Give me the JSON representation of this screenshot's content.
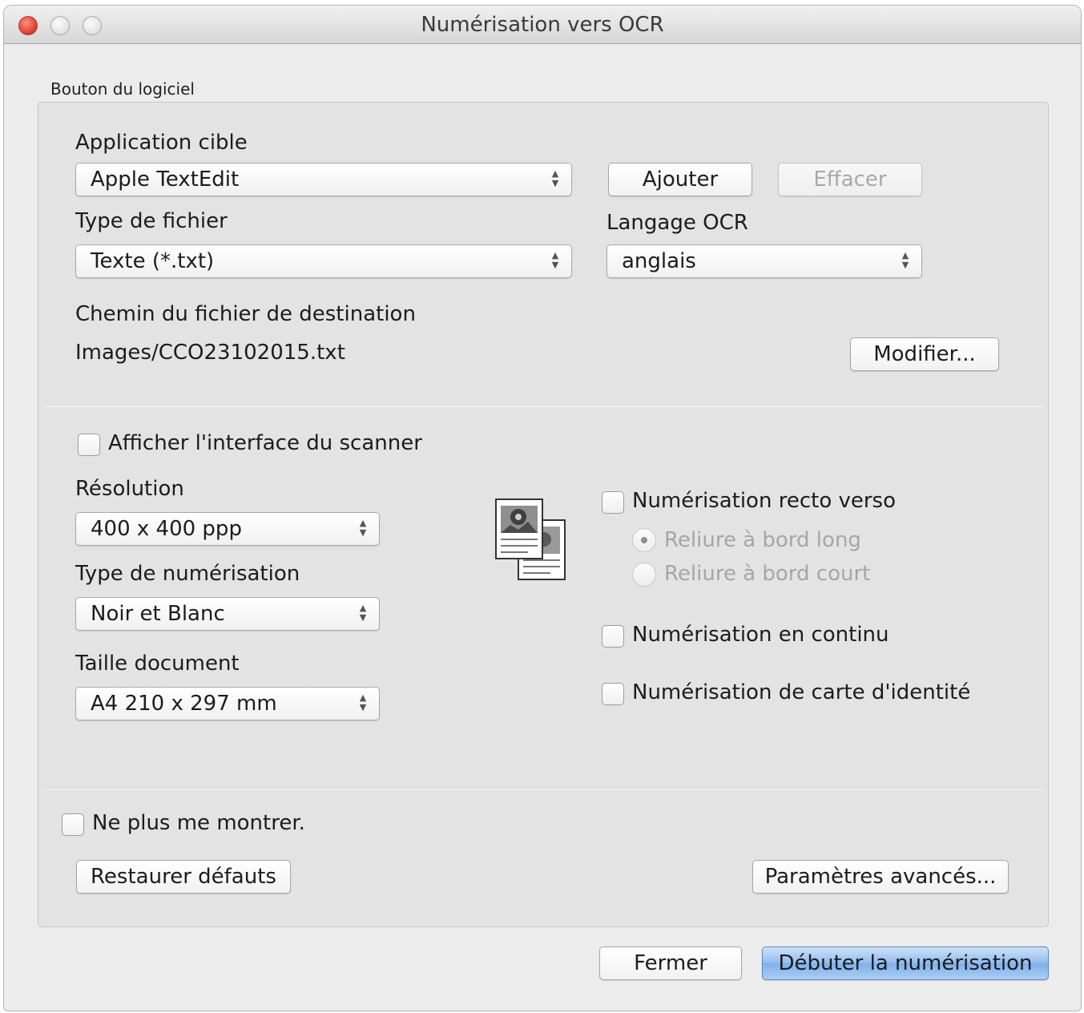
{
  "window": {
    "title": "Numérisation vers OCR"
  },
  "group": {
    "label": "Bouton du logiciel"
  },
  "target_app": {
    "label": "Application cible",
    "value": "Apple TextEdit",
    "add_button": "Ajouter",
    "delete_button": "Effacer"
  },
  "file_type": {
    "label": "Type de fichier",
    "value": "Texte (*.txt)"
  },
  "ocr_language": {
    "label": "Langage OCR",
    "value": "anglais"
  },
  "destination": {
    "label": "Chemin du fichier de destination",
    "path": "Images/CCO23102015.txt",
    "modify_button": "Modifier..."
  },
  "scanner_ui": {
    "label": "Afficher l'interface du scanner",
    "checked": false
  },
  "resolution": {
    "label": "Résolution",
    "value": "400 x 400 ppp"
  },
  "scan_type": {
    "label": "Type de numérisation",
    "value": "Noir et Blanc"
  },
  "doc_size": {
    "label": "Taille document",
    "value": "A4 210 x 297 mm"
  },
  "duplex": {
    "label": "Numérisation recto verso",
    "checked": false,
    "long_edge": "Reliure à bord long",
    "short_edge": "Reliure à bord court",
    "selected": "long_edge"
  },
  "continuous": {
    "label": "Numérisation en continu",
    "checked": false
  },
  "id_card": {
    "label": "Numérisation de carte d'identité",
    "checked": false
  },
  "dont_show": {
    "label": "Ne plus me montrer.",
    "checked": false
  },
  "restore_button": "Restaurer défauts",
  "advanced_button": "Paramètres avancés...",
  "close_button": "Fermer",
  "start_button": "Débuter la numérisation",
  "icons": {
    "duplex_pages": "duplex-document-icon",
    "popup_arrows": "up-down-arrows-icon"
  },
  "colors": {
    "default_button": "#8ebbf0",
    "close_light": "#e0443a"
  }
}
